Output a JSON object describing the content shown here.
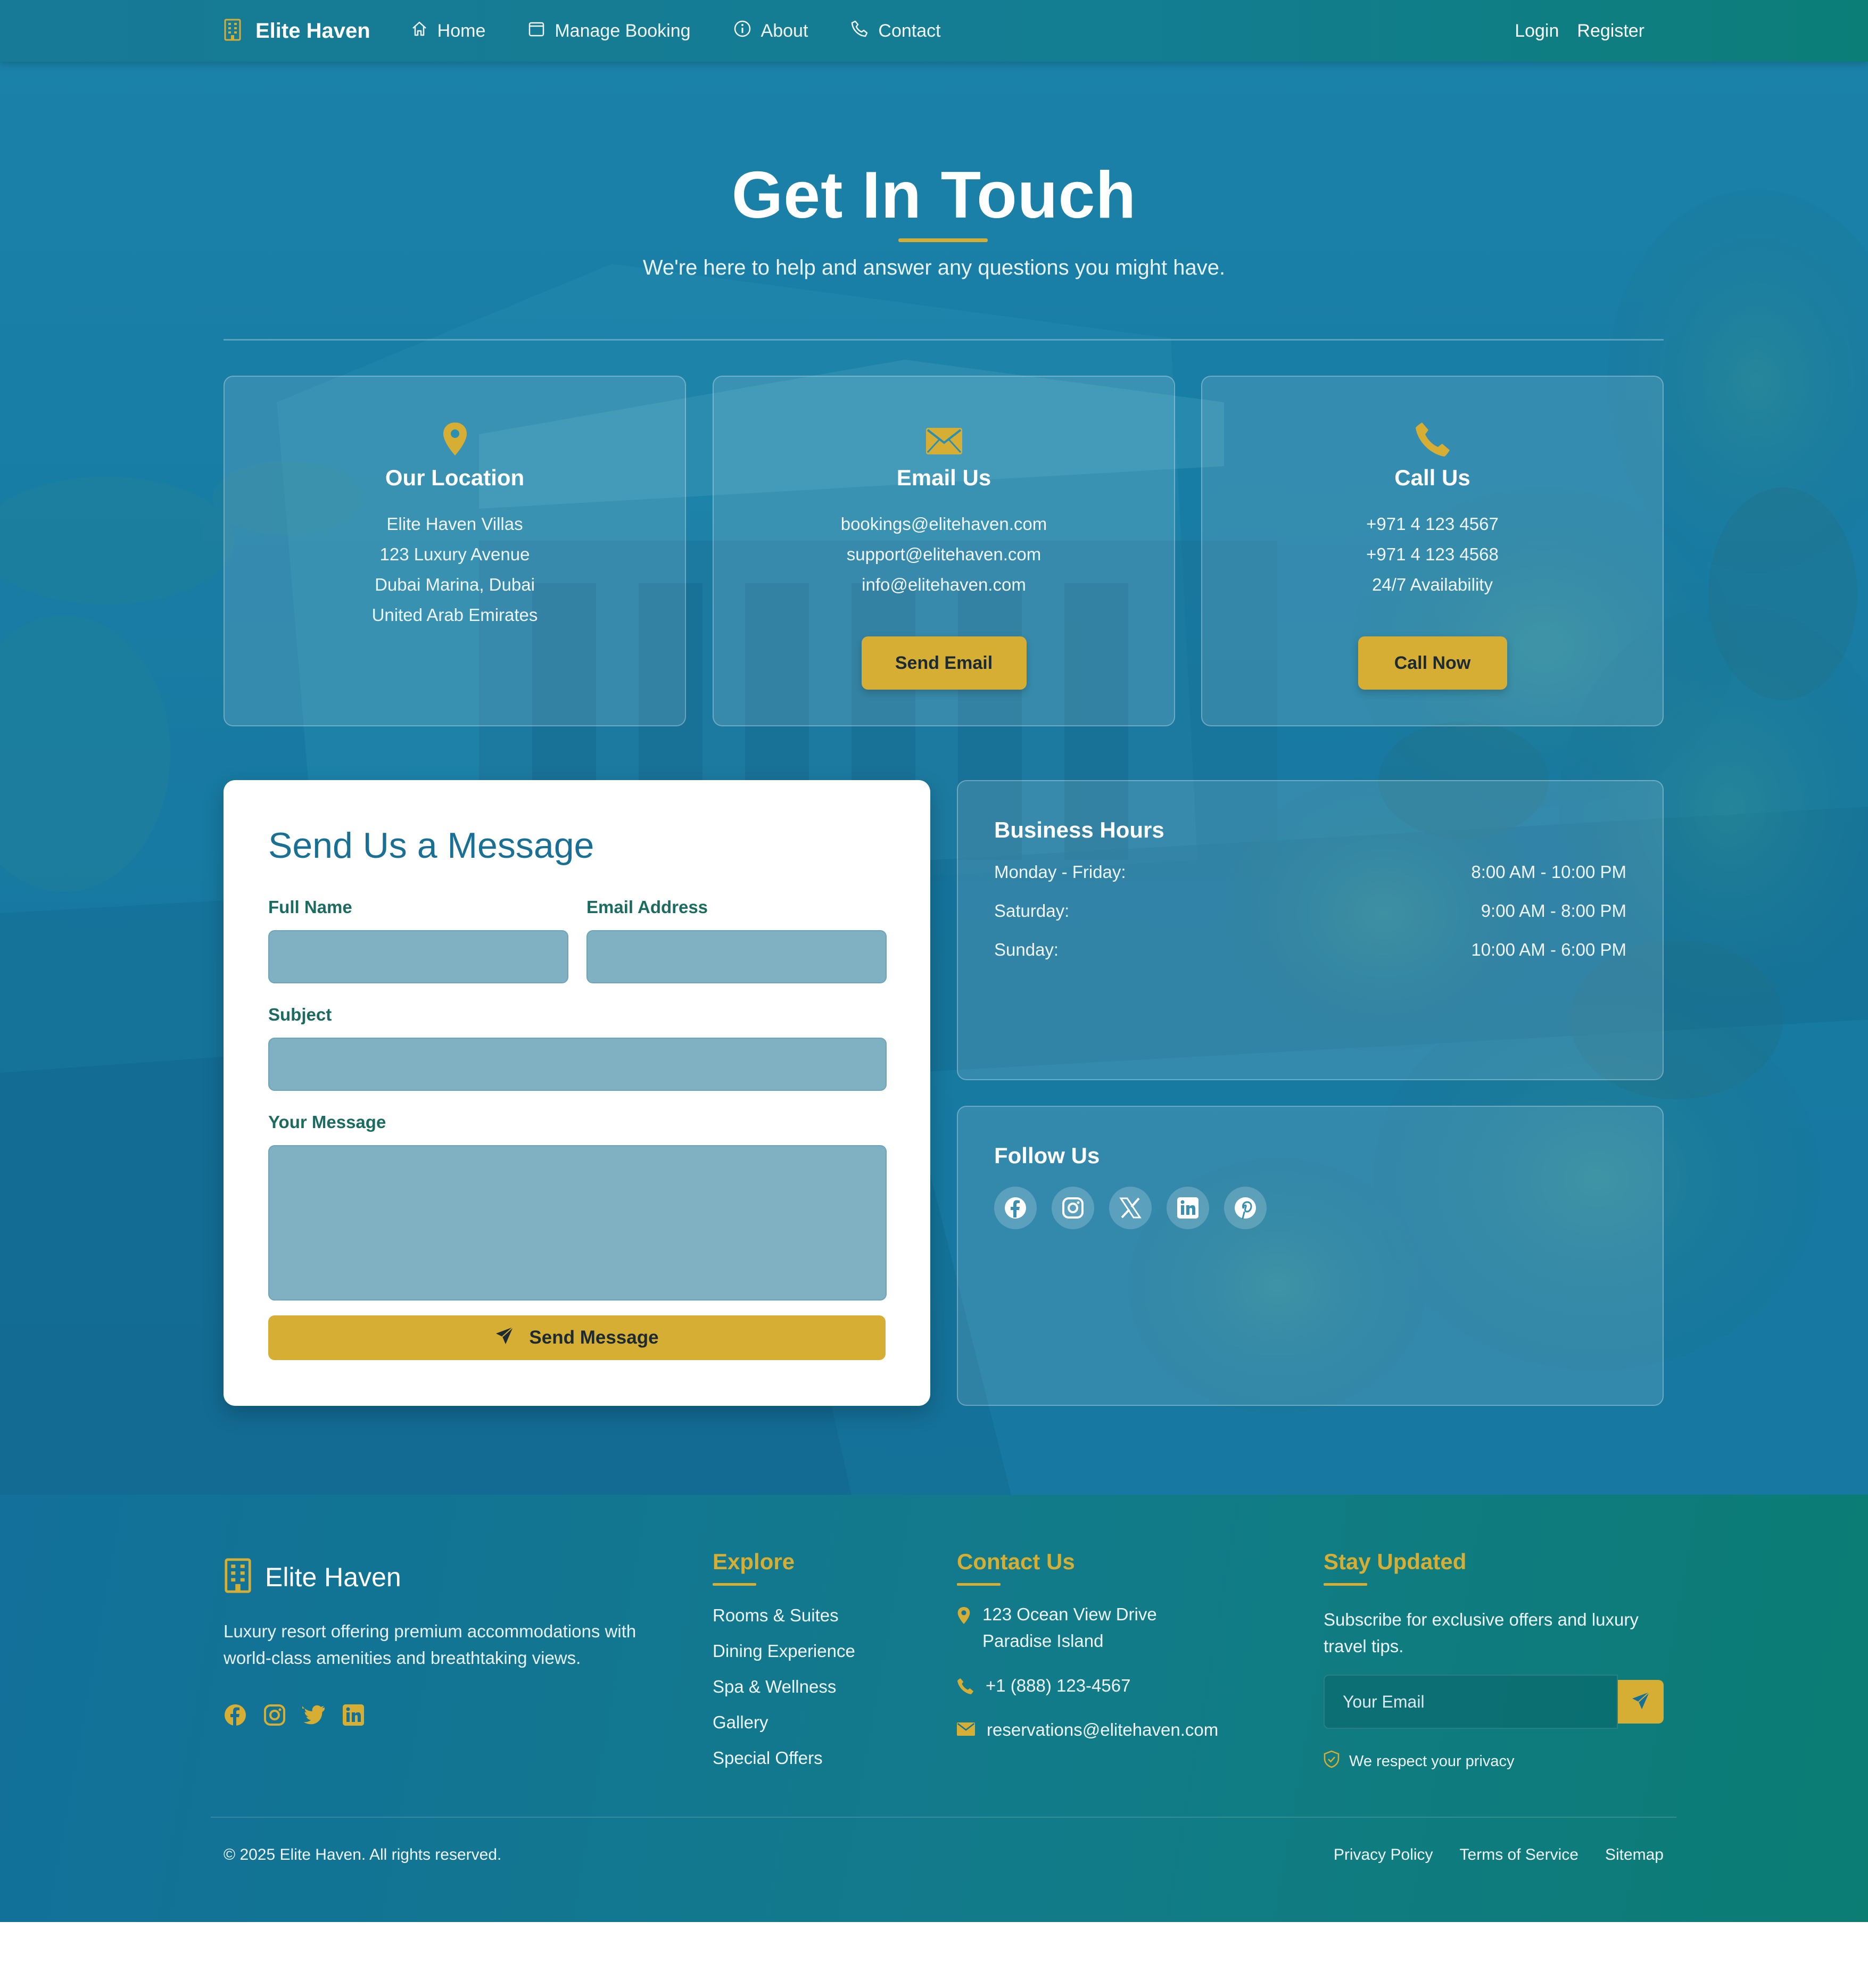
{
  "nav": {
    "brand": "Elite Haven",
    "links": [
      {
        "label": "Home",
        "icon": "home-icon"
      },
      {
        "label": "Manage Booking",
        "icon": "calendar-icon"
      },
      {
        "label": "About",
        "icon": "info-icon"
      },
      {
        "label": "Contact",
        "icon": "phone-icon"
      }
    ],
    "login": "Login",
    "register": "Register"
  },
  "hero": {
    "title": "Get In Touch",
    "subtitle": "We're here to help and answer any questions you might have."
  },
  "cards": [
    {
      "icon": "location-pin-icon",
      "title": "Our Location",
      "lines": [
        "Elite Haven Villas",
        "123 Luxury Avenue",
        "Dubai Marina, Dubai",
        "United Arab Emirates"
      ]
    },
    {
      "icon": "envelope-icon",
      "title": "Email Us",
      "lines": [
        "bookings@elitehaven.com",
        "support@elitehaven.com",
        "info@elitehaven.com"
      ],
      "button": "Send Email"
    },
    {
      "icon": "phone-icon",
      "title": "Call Us",
      "lines": [
        "+971 4 123 4567",
        "+971 4 123 4568",
        "24/7 Availability"
      ],
      "button": "Call Now"
    }
  ],
  "form": {
    "title": "Send Us a Message",
    "full_name_label": "Full Name",
    "full_name_value": "",
    "email_label": "Email Address",
    "email_value": "",
    "subject_label": "Subject",
    "subject_value": "",
    "message_label": "Your Message",
    "message_value": "",
    "submit_label": "Send Message"
  },
  "hours": {
    "title": "Business Hours",
    "rows": [
      {
        "day": "Monday - Friday:",
        "time": "8:00 AM - 10:00 PM"
      },
      {
        "day": "Saturday:",
        "time": "9:00 AM - 8:00 PM"
      },
      {
        "day": "Sunday:",
        "time": "10:00 AM - 6:00 PM"
      }
    ]
  },
  "follow": {
    "title": "Follow Us",
    "icons": [
      "facebook-icon",
      "instagram-icon",
      "x-icon",
      "linkedin-icon",
      "pinterest-icon"
    ]
  },
  "footer": {
    "brand": "Elite Haven",
    "description": "Luxury resort offering premium accommodations with world-class amenities and breathtaking views.",
    "social_icons": [
      "facebook-icon",
      "instagram-icon",
      "twitter-icon",
      "linkedin-icon"
    ],
    "explore": {
      "title": "Explore",
      "links": [
        "Rooms & Suites",
        "Dining Experience",
        "Spa & Wellness",
        "Gallery",
        "Special Offers"
      ]
    },
    "contact": {
      "title": "Contact Us",
      "address_line1": "123 Ocean View Drive",
      "address_line2": "Paradise Island",
      "phone": "+1 (888) 123-4567",
      "email": "reservations@elitehaven.com"
    },
    "newsletter": {
      "title": "Stay Updated",
      "text": "Subscribe for exclusive offers and luxury travel tips.",
      "placeholder": "Your Email",
      "privacy": "We respect your privacy"
    },
    "copyright": "© 2025 Elite Haven. All rights reserved.",
    "legal": [
      "Privacy Policy",
      "Terms of Service",
      "Sitemap"
    ]
  },
  "colors": {
    "accent": "#d6ae33",
    "primary": "#1a7aa1",
    "teal": "#0b7d73"
  }
}
